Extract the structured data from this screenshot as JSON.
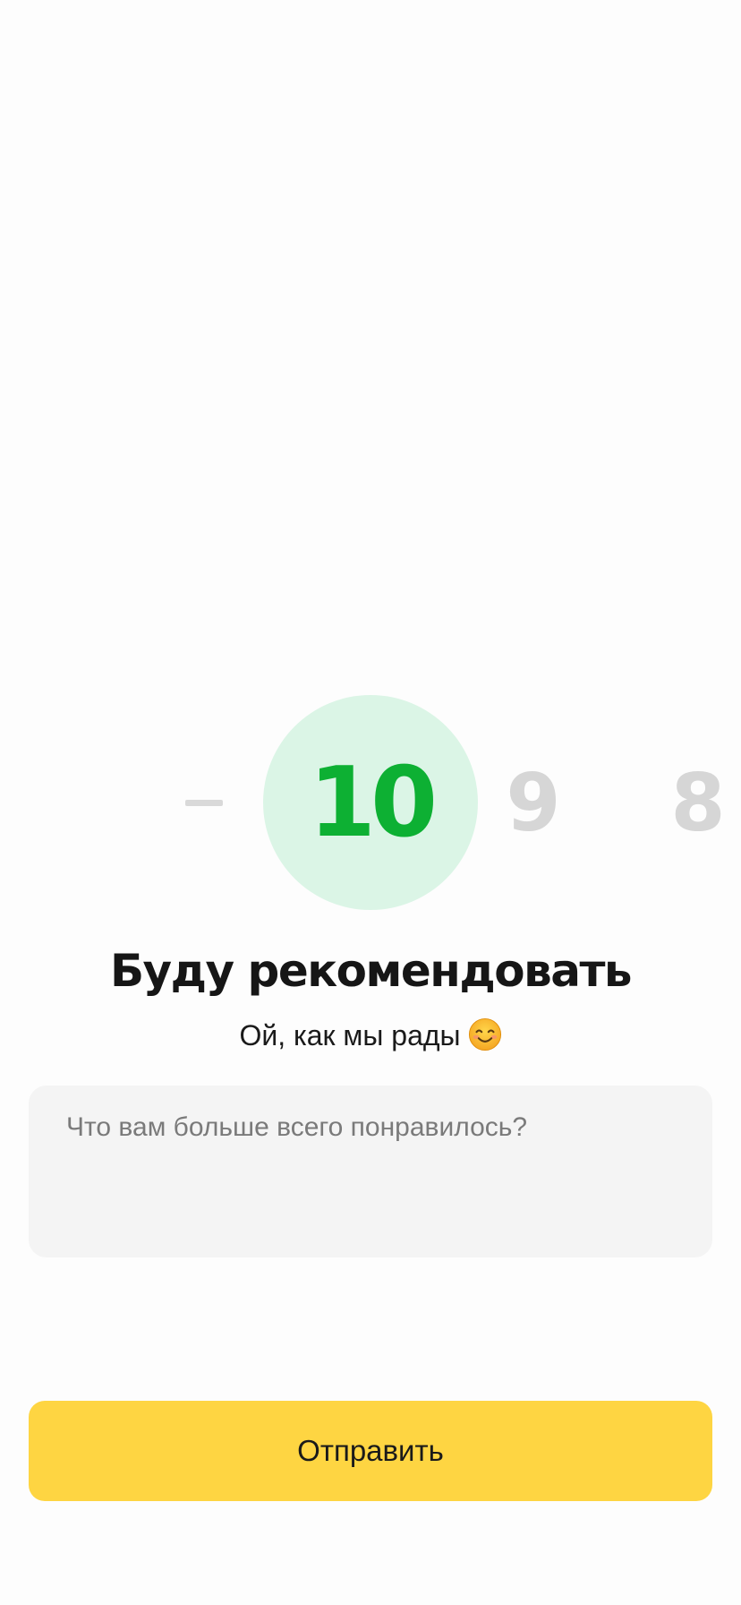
{
  "rating": {
    "options": [
      "–",
      "10",
      "9",
      "8"
    ],
    "selected": "10",
    "selected_color": "#0db033",
    "selected_bg": "#dbf5e6",
    "inactive_color": "#d6d6d6"
  },
  "title": "Буду рекомендовать",
  "subtitle": "Ой, как мы рады",
  "subtitle_emoji": "smiling-face-emoji",
  "feedback": {
    "value": "",
    "placeholder": "Что вам больше всего понравилось?"
  },
  "submit": {
    "label": "Отправить",
    "color": "#fed542"
  }
}
